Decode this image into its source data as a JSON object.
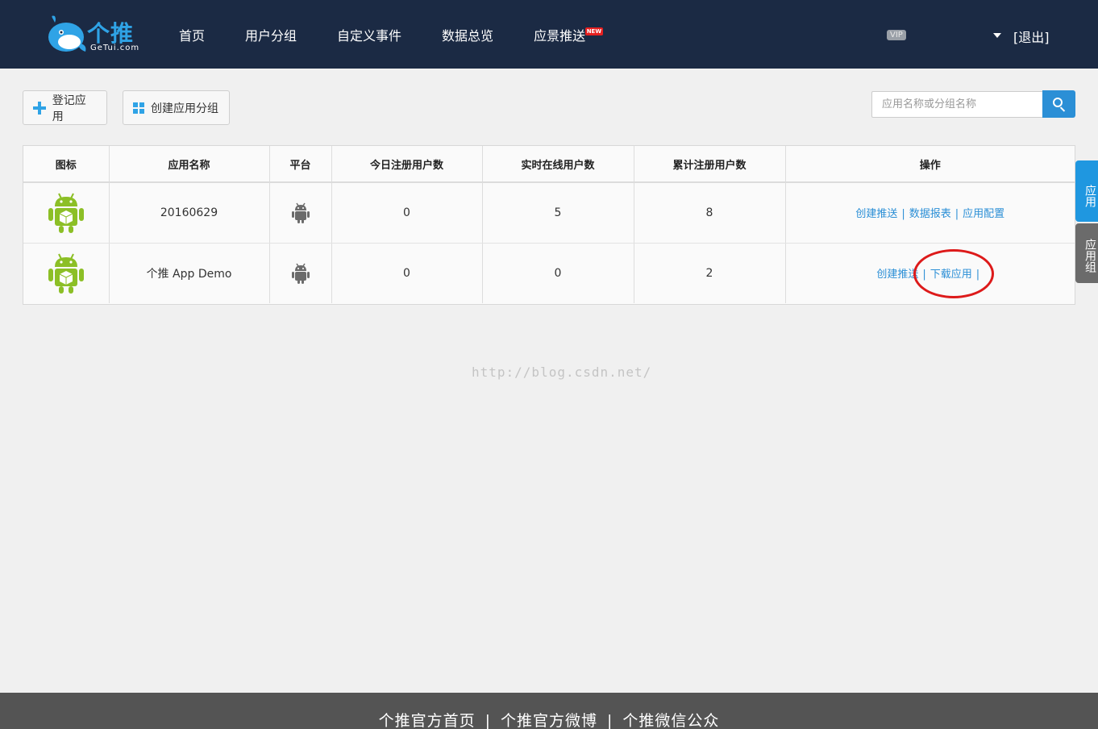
{
  "header": {
    "logo_text": "个推",
    "logo_sub": "GeTui.com",
    "nav": [
      "首页",
      "用户分组",
      "自定义事件",
      "数据总览",
      "应景推送"
    ],
    "new_badge": "NEW",
    "vip_badge": "VIP",
    "logout": "[退出]"
  },
  "toolbar": {
    "register_app": "登记应用",
    "create_group": "创建应用分组",
    "search_placeholder": "应用名称或分组名称"
  },
  "table": {
    "headers": [
      "图标",
      "应用名称",
      "平台",
      "今日注册用户数",
      "实时在线用户数",
      "累计注册用户数",
      "操作"
    ],
    "rows": [
      {
        "name": "20160629",
        "platform": "android-icon",
        "today_reg": "0",
        "online": "5",
        "total_reg": "8",
        "actions": [
          "创建推送",
          "数据报表",
          "应用配置"
        ]
      },
      {
        "name": "个推 App Demo",
        "platform": "android-icon",
        "today_reg": "0",
        "online": "0",
        "total_reg": "2",
        "actions": [
          "创建推送",
          "下载应用"
        ]
      }
    ]
  },
  "side_tabs": {
    "app": "应用",
    "group": "应用组"
  },
  "watermark": "http://blog.csdn.net/",
  "footer": {
    "links": [
      "个推官方首页",
      "个推官方微博",
      "个推微信公众"
    ],
    "separator": "|"
  },
  "colors": {
    "header_bg": "#1b2a44",
    "accent": "#2b8fd6",
    "android_green": "#8cbf26",
    "footer_bg": "#545454",
    "highlight_circle": "#dd1a1a"
  }
}
